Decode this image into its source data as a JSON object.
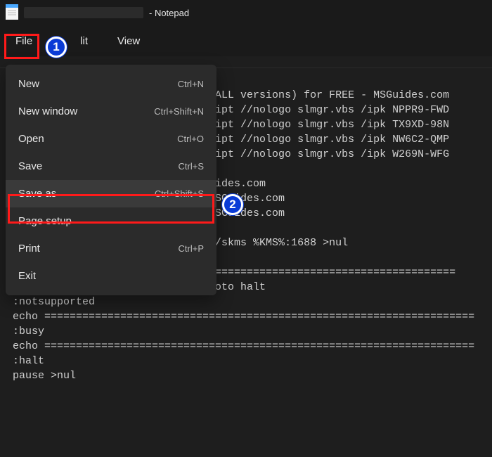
{
  "title": {
    "app": "- Notepad"
  },
  "menubar": {
    "file": "File",
    "edit": "lit",
    "view": "View"
  },
  "dropdown": {
    "new": {
      "label": "New",
      "shortcut": "Ctrl+N"
    },
    "newwindow": {
      "label": "New window",
      "shortcut": "Ctrl+Shift+N"
    },
    "open": {
      "label": "Open",
      "shortcut": "Ctrl+O"
    },
    "save": {
      "label": "Save",
      "shortcut": "Ctrl+S"
    },
    "saveas": {
      "label": "Save as",
      "shortcut": "Ctrl+Shift+S"
    },
    "pagesetup": {
      "label": "Page setup",
      "shortcut": ""
    },
    "print": {
      "label": "Print",
      "shortcut": "Ctrl+P"
    },
    "exit": {
      "label": "Exit",
      "shortcut": ""
    }
  },
  "callouts": {
    "one": "1",
    "two": "2"
  },
  "editor": {
    "text": "                                ALL versions) for FREE - MSGuides.com\n                                ipt //nologo slmgr.vbs /ipk NPPR9-FWD\n                                ipt //nologo slmgr.vbs /ipk TX9XD-98N\n                                ipt //nologo slmgr.vbs /ipk NW6C2-QMP\n                                ipt //nologo slmgr.vbs /ipk W269N-WFG\n\n                                ides.com\n                                SGuides.com\n                                SGuides.com\n\n                                /skms %KMS%:1688 >nul\n\n                                ======================================\nexplorer \"http://MSGuides.com\"&goto halt\n:notsupported\necho ====================================================================\n:busy\necho ====================================================================\n:halt\npause >nul"
  }
}
